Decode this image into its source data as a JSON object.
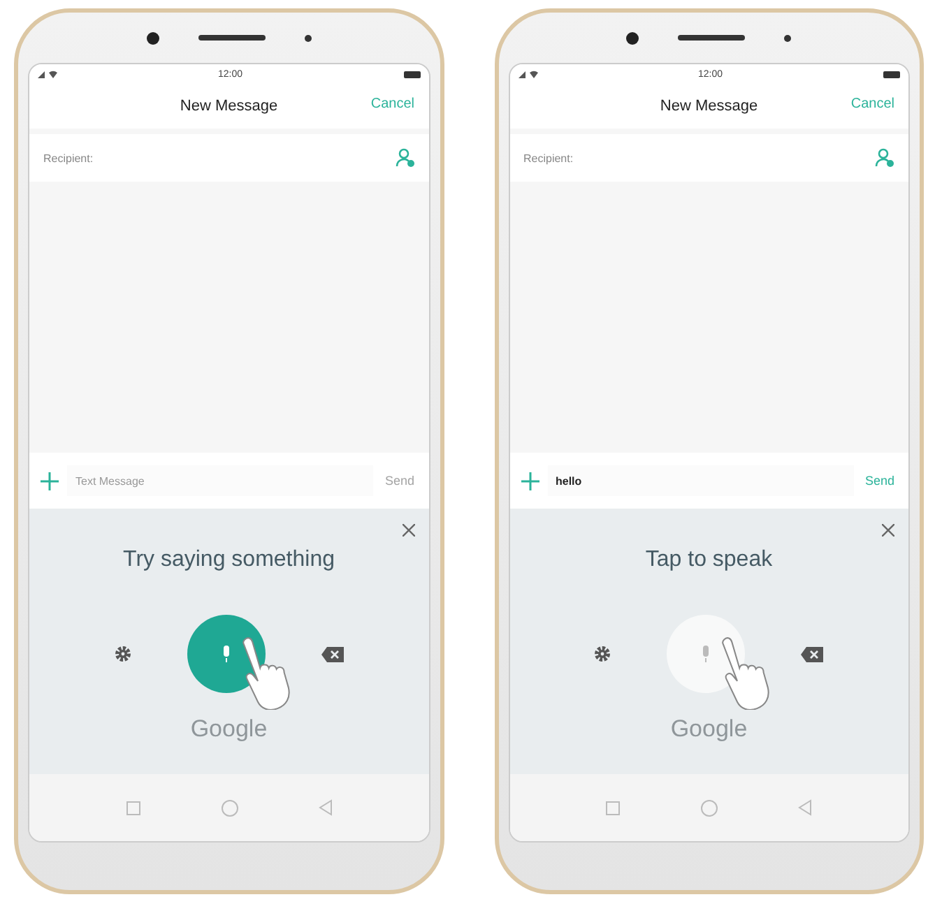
{
  "phones": [
    {
      "status_bar": {
        "time": "12:00"
      },
      "header": {
        "title": "New Message",
        "cancel": "Cancel"
      },
      "recipient": {
        "label": "Recipient:"
      },
      "compose": {
        "placeholder": "Text Message",
        "send": {
          "label": "Send",
          "disabled": true
        }
      },
      "voice": {
        "prompt": "Try saying something",
        "listening": true,
        "brand": "Google"
      }
    },
    {
      "status_bar": {
        "time": "12:00"
      },
      "header": {
        "title": "New Message",
        "cancel": "Cancel"
      },
      "recipient": {
        "label": "Recipient:"
      },
      "compose": {
        "value": "hello",
        "send": {
          "label": "Send",
          "disabled": false
        }
      },
      "voice": {
        "prompt": "Tap to speak",
        "listening": false,
        "brand": "Google"
      }
    }
  ]
}
